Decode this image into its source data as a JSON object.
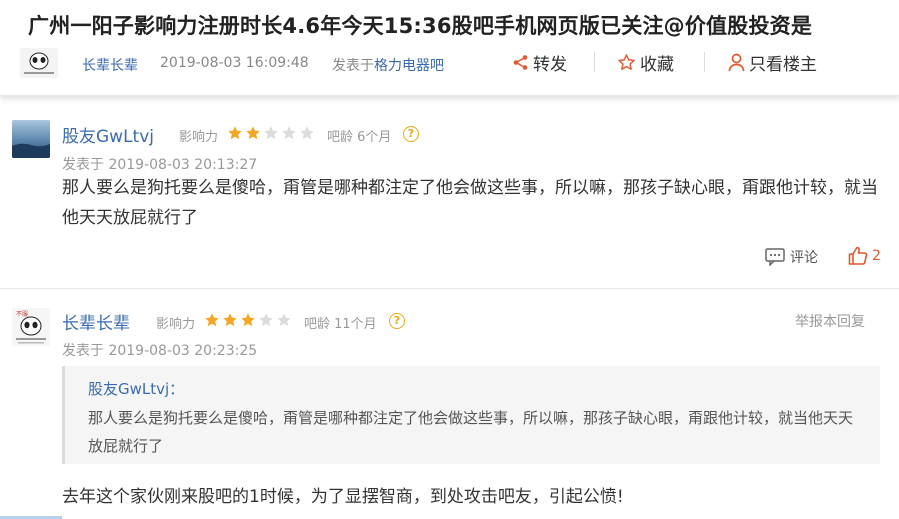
{
  "post": {
    "title": "广州一阳子影响力注册时长4.6年今天15:36股吧手机网页版已关注@价值股投资是",
    "author": "长辈长辈",
    "time": "2019-08-03 16:09:48",
    "posted_in_label": "发表于",
    "forum": "格力电器吧",
    "actions": {
      "share": "转发",
      "favorite": "收藏",
      "host_only": "只看楼主"
    }
  },
  "replies": [
    {
      "username": "股友GwLtvj",
      "influence_label": "影响力",
      "stars": 2,
      "age": "吧龄 6个月",
      "time": "发表于 2019-08-03 20:13:27",
      "content": "那人要么是狗托要么是傻哈，甭管是哪种都注定了他会做这些事，所以嘛，那孩子缺心眼，甭跟他计较，就当他天天放屁就行了",
      "comment_label": "评论",
      "likes": "2"
    },
    {
      "username": "长辈长辈",
      "influence_label": "影响力",
      "stars": 3,
      "age": "吧龄 11个月",
      "time": "发表于 2019-08-03 20:23:25",
      "report_label": "举报本回复",
      "quote": {
        "author": "股友GwLtvj：",
        "text": "那人要么是狗托要么是傻哈，甭管是哪种都注定了他会做这些事，所以嘛，那孩子缺心眼，甭跟他计较，就当他天天放屁就行了"
      },
      "content": "去年这个家伙刚来股吧的1时候，为了显摆智商，到处攻击吧友，引起公愤!"
    }
  ],
  "colors": {
    "link": "#3a6bb0",
    "star": "#f5a623",
    "like": "#e4572e"
  }
}
